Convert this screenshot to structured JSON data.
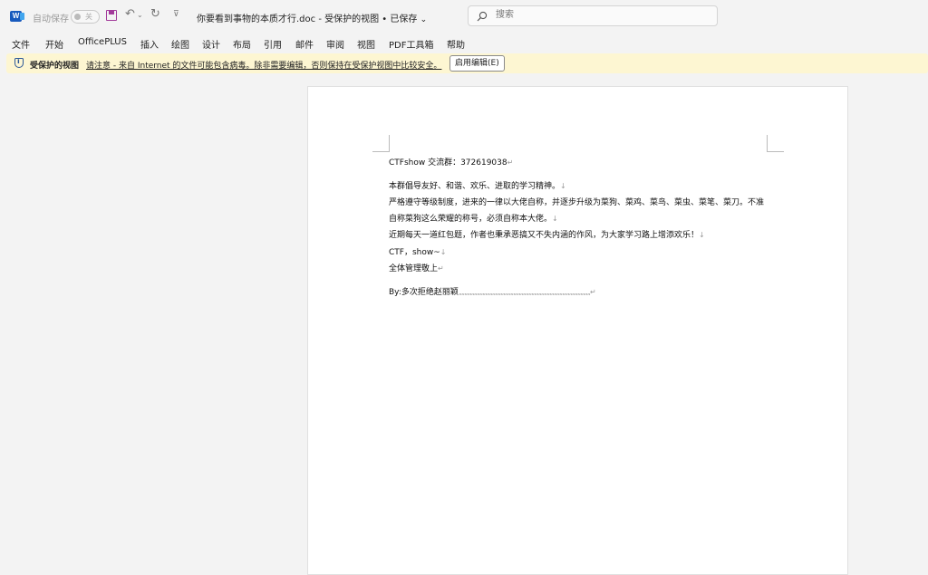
{
  "titlebar": {
    "app_icon": "word-icon",
    "app_letter": "W",
    "autosave_label": "自动保存",
    "autosave_state": "关",
    "quick_access_icons": [
      "save-icon",
      "undo-icon",
      "redo-icon",
      "customize-icon"
    ],
    "document_title": "你要看到事物的本质才行.doc - 受保护的视图 • 已保存"
  },
  "search": {
    "placeholder": "搜索",
    "icon": "search-icon"
  },
  "menu": {
    "items": [
      "文件",
      "开始",
      "OfficePLUS",
      "插入",
      "绘图",
      "设计",
      "布局",
      "引用",
      "邮件",
      "审阅",
      "视图",
      "PDF工具箱",
      "帮助"
    ]
  },
  "infobar": {
    "icon": "shield-icon",
    "title": "受保护的视图",
    "message": "请注意 - 来自 Internet 的文件可能包含病毒。除非需要编辑，否则保持在受保护视图中比较安全。",
    "button": "启用编辑(E)",
    "background": "#fdf6d2"
  },
  "document": {
    "lines": [
      "CTFshow 交流群：372619038",
      "本群倡导友好、和谐、欢乐、进取的学习精神。",
      "严格遵守等级制度，进来的一律以大佬自称，并逐步升级为菜狗、菜鸡、菜鸟、菜虫、菜笔、菜刀。不准",
      "自称菜狗这么荣耀的称号，必须自称本大佬。",
      "近期每天一道红包题，作者也秉承恶搞又不失内涵的作风，为大家学习路上增添欢乐！",
      "CTF，show~",
      "全体管理敬上",
      "By:多次拒绝赵丽颖"
    ],
    "trailing_marks": ",,,,,,,,,,,,,,,,,,,,,,,,,,,,,,,,,,,,,,,,,,,,,,,,,,,,,,,,,,,,,,,,,,,,,,,,,,,,,,,,,,,,,,,,,,,,,,",
    "line_break_mark": "↓",
    "paragraph_mark": "↵"
  },
  "colors": {
    "word_blue": "#185abd",
    "save_purple": "#a23a9a",
    "infobar_bg": "#fdf6d2"
  }
}
